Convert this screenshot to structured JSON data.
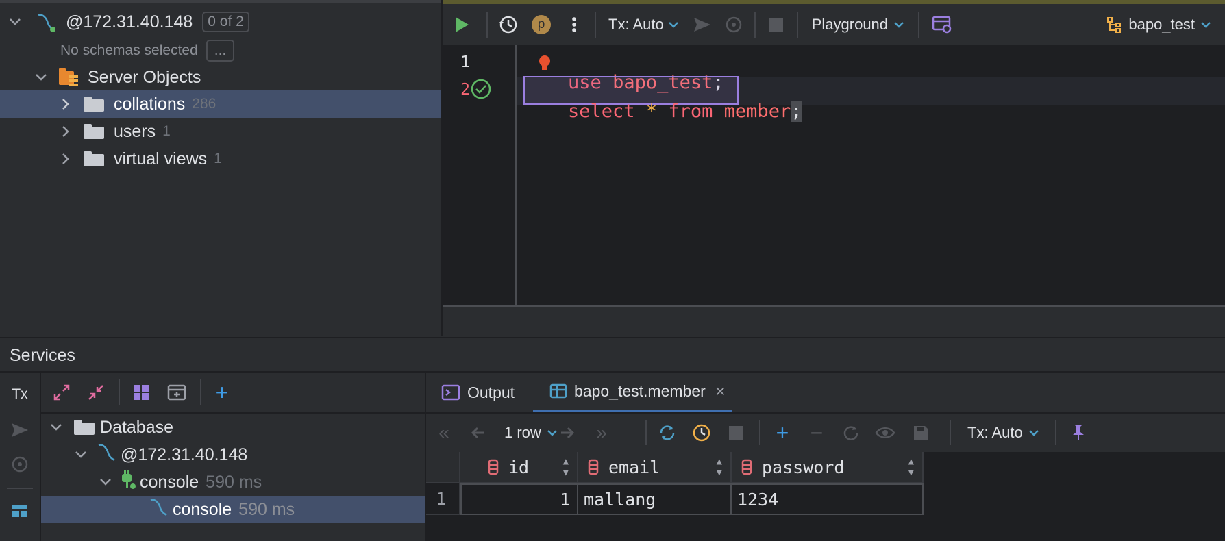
{
  "left_tree": {
    "connection": {
      "label": "@172.31.40.148",
      "badge": "0 of 2"
    },
    "no_schemas": {
      "label": "No schemas selected",
      "button": "..."
    },
    "server_objects": {
      "label": "Server Objects"
    },
    "items": [
      {
        "label": "collations",
        "count": "286",
        "selected": true
      },
      {
        "label": "users",
        "count": "1",
        "selected": false
      },
      {
        "label": "virtual views",
        "count": "1",
        "selected": false
      }
    ]
  },
  "editor_toolbar": {
    "tx_label": "Tx: Auto",
    "playground_label": "Playground",
    "schema_label": "bapo_test",
    "p_badge": "p"
  },
  "editor": {
    "lines": [
      {
        "no": "1",
        "kw": "use",
        "ident": "bapo_test",
        "end": ";"
      },
      {
        "no": "2",
        "kw": "select",
        "star": "*",
        "kw2": "from",
        "ident": "member",
        "end": ";"
      }
    ]
  },
  "services": {
    "title": "Services",
    "tx_label": "Tx",
    "tree": [
      {
        "label": "Database"
      },
      {
        "label": "@172.31.40.148"
      },
      {
        "label": "console",
        "time": "590 ms"
      },
      {
        "label": "console",
        "time": "590 ms",
        "selected": true
      }
    ]
  },
  "results": {
    "tabs": [
      {
        "label": "Output"
      },
      {
        "label": "bapo_test.member",
        "close": "×"
      }
    ],
    "row_count": "1 row",
    "tx_label": "Tx: Auto",
    "columns": [
      "id",
      "email",
      "password"
    ],
    "rows": [
      {
        "row_no": "1",
        "id": "1",
        "email": "mallang",
        "password": "1234"
      }
    ]
  },
  "colors": {
    "accent_green": "#5fb865",
    "keyword_pink": "#fa6675",
    "selection_blue": "#43506b",
    "plus_blue": "#3f9be4",
    "column_icon_red": "#e06c75"
  }
}
